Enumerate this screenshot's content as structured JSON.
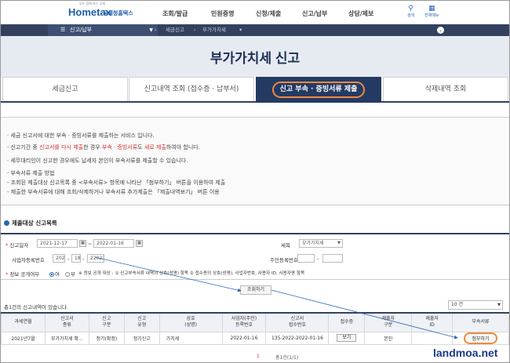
{
  "header": {
    "logo_text": "Hometax",
    "logo_small": "모두 함께 하는 국세",
    "logo_sub": "국세청홈택스",
    "gnb": [
      "조회/발급",
      "민원증명",
      "신청/제출",
      "신고/납부",
      "상담/제보"
    ],
    "search_label": "검색",
    "menu_label": "전체메뉴"
  },
  "nav": {
    "menu": "신고/납부",
    "crumbs": [
      "세금신고",
      "부가가치세"
    ]
  },
  "hero": {
    "title": "부가가치세 신고"
  },
  "tabs": [
    {
      "label": "세금신고"
    },
    {
      "label": "신고내역 조회 (접수증 · 납부서)"
    },
    {
      "label": "신고 부속 · 증빙서류 제출"
    },
    {
      "label": "삭제내역 조회"
    }
  ],
  "info": {
    "line1": "· 세금 신고서에 대한 부속 · 증빙서류를 제출하는 서비스 입니다.",
    "line2_a": "· 신고기간 중 ",
    "line2_b": "신고서를 다시 제출",
    "line2_c": "한 경우 ",
    "line2_d": "부속 · 증빙서류",
    "line2_e": "도 ",
    "line2_f": "새로 제출",
    "line2_g": "하여야 합니다.",
    "line3": "· 세무대리인이 신고한 경우에도 납세자 본인이 부속서류를 제출할 수 있습니다.",
    "line4": "· 부속서류 제출 방법",
    "line5": "  - 조회된 제출대상 신고목록 중 <부속서류> 항목에 나타난 「첨부하기」 버튼을 이용하여 제출",
    "line6": "  - 제출한 부속서류에 대해 조회/삭제하거나 부속서류 추가제출은 「제출내역보기」 버튼 이용"
  },
  "section": {
    "title": "제출대상 신고목록"
  },
  "form": {
    "period_label": "신고일자",
    "date_from": "2021-12-17",
    "date_to": "2022-01-16",
    "tax_label": "세목",
    "tax_value": "부가가치세",
    "bizno_label": "사업자등록번호",
    "biz1": "202",
    "biz2": "18",
    "biz3": "22023",
    "resno_label": "주민등록번호",
    "consent_label": "정보 공개여부",
    "yes": "여",
    "no": "부",
    "consent_note": "※ 정보 공개 대상 : ① 신고부속서류 내역의 상호(성명) 항목 ② 접수증의 상호(성명), 사업자번호, 사용자 ID, 사용자명 항목",
    "search_button": "조회하기"
  },
  "result": {
    "count_text": "총1건의 신고내역이 있습니다.",
    "page_size": "10 건"
  },
  "table": {
    "headers": [
      "과세연월",
      "신고서\n종류",
      "신고\n구분",
      "신고\n유형",
      "상호\n(성명)",
      "사업자(주민)\n등록번호",
      "신고서\n접수번호",
      "접수증",
      "제출자\n구분",
      "제출자\nID",
      "부속서류"
    ],
    "rows": [
      [
        "2021년7월",
        "부가가치세 확...",
        "정기(확정)",
        "정기신고",
        "가치세",
        "2022-01-16",
        "135-2022-",
        "2022-01-16",
        "보기",
        "본인",
        "",
        "첨부하기"
      ]
    ]
  },
  "pager": {
    "page": "1",
    "total": "총1건(1/1)"
  },
  "watermark": "landmoa.net"
}
